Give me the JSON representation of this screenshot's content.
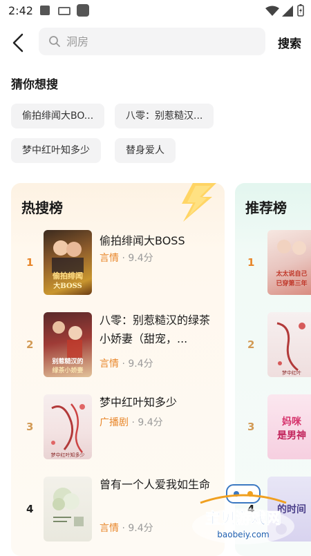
{
  "status_bar": {
    "time": "2:42"
  },
  "search": {
    "placeholder": "洞房",
    "button_label": "搜索"
  },
  "suggest": {
    "title": "猜你想搜",
    "chips": [
      "偷拍绯闻大BO...",
      "八零：别惹糙汉...",
      "梦中红叶知多少",
      "替身爱人"
    ]
  },
  "hot": {
    "title": "热搜榜",
    "items": [
      {
        "rank": "1",
        "title": "偷拍绯闻大BOSS",
        "genre": "言情",
        "score": "· 9.4分",
        "cover_text": "偷拍绯闻大BOSS"
      },
      {
        "rank": "2",
        "title": "八零：别惹糙汉的绿茶小娇妻（甜宠，...",
        "genre": "言情",
        "score": "· 9.4分",
        "cover_text": "别惹糙汉的绿茶小娇妻"
      },
      {
        "rank": "3",
        "title": "梦中红叶知多少",
        "genre": "广播剧",
        "score": "· 9.4分",
        "cover_text": "梦中红叶知多少"
      },
      {
        "rank": "4",
        "title": "曾有一个人爱我如生命",
        "genre": "言情",
        "score": "· 9.4分",
        "cover_text": "曾有一个人爱我如生命"
      }
    ]
  },
  "recommend": {
    "title": "推荐榜",
    "items": [
      {
        "rank": "1",
        "cover_text": "太太说自己已穿第三年"
      },
      {
        "rank": "2",
        "cover_text": "梦中红叶"
      },
      {
        "rank": "3",
        "cover_text": "妈咪是男神"
      },
      {
        "rank": "4",
        "cover_text": "的时间"
      }
    ]
  },
  "watermark": {
    "brand": "宝贝游戏网",
    "url": "baobeiy.com"
  },
  "colors": {
    "accent": "#e8862a",
    "rank_top": "#e8862a",
    "rank_other": "#d29a55",
    "hot_bg": "#fdf2e3",
    "rec_bg": "#e3f6ef"
  }
}
